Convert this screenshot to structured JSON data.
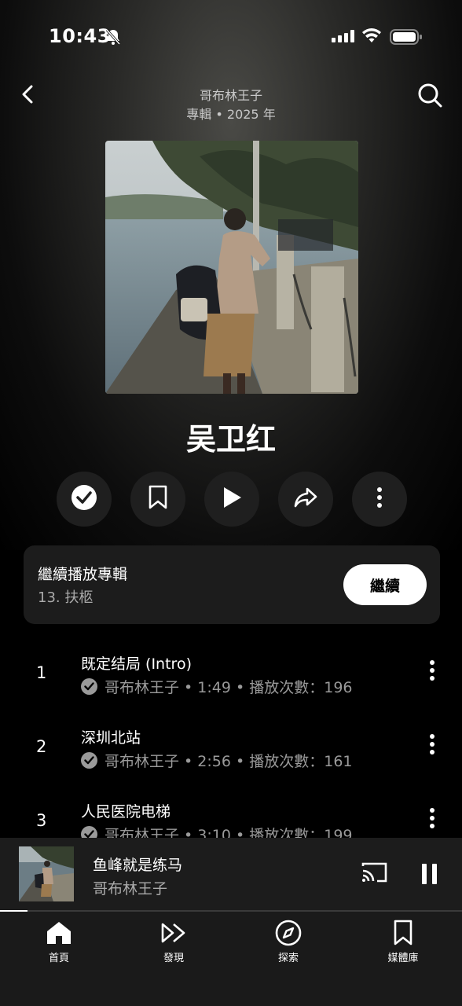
{
  "status_bar": {
    "time": "10:43"
  },
  "header": {
    "artist": "哥布林王子",
    "meta": "專輯 • 2025 年"
  },
  "album": {
    "title": "吴卫红"
  },
  "continue_card": {
    "title": "繼續播放專輯",
    "subtitle": "13. 扶柩",
    "button": "繼續"
  },
  "tracks": [
    {
      "num": "1",
      "title": "既定结局 (Intro)",
      "meta": "哥布林王子 • 1:49 • 播放次數：196"
    },
    {
      "num": "2",
      "title": "深圳北站",
      "meta": "哥布林王子 • 2:56 • 播放次數：161"
    },
    {
      "num": "3",
      "title": "人民医院电梯",
      "meta": "哥布林王子 • 3:10 • 播放次數：199"
    }
  ],
  "mini_player": {
    "title": "鱼峰就是练马",
    "artist": "哥布林王子",
    "progress": 0.06
  },
  "nav": [
    {
      "label": "首頁",
      "icon": "home-icon"
    },
    {
      "label": "發現",
      "icon": "discover-icon"
    },
    {
      "label": "探索",
      "icon": "compass-icon"
    },
    {
      "label": "媒體庫",
      "icon": "library-icon"
    }
  ]
}
